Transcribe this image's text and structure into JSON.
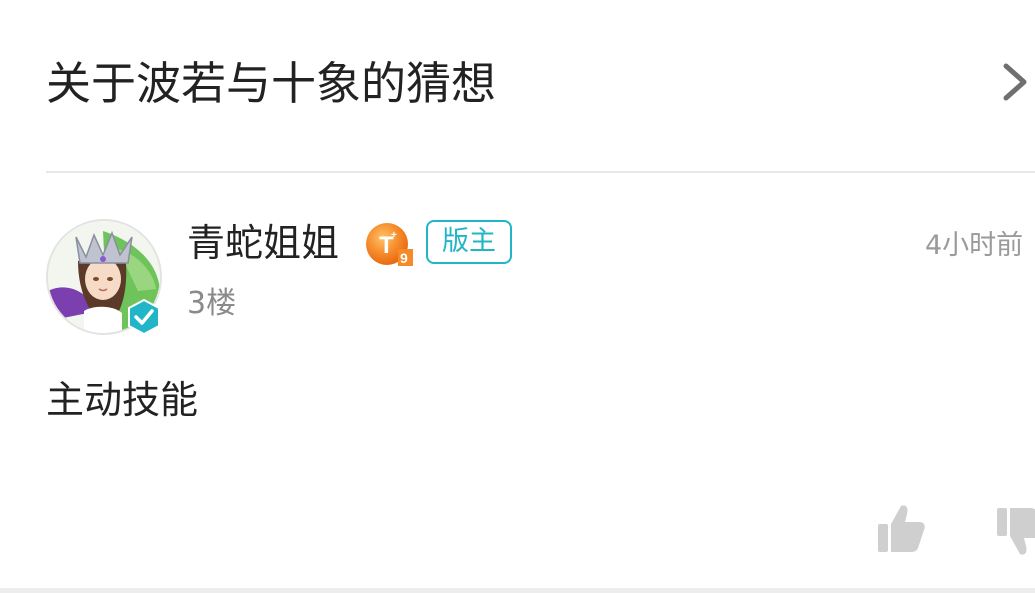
{
  "thread": {
    "title": "关于波若与十象的猜想"
  },
  "post": {
    "username": "青蛇姐姐",
    "level_badge": "T9",
    "role_badge": "版主",
    "floor": "3楼",
    "time": "4小时前",
    "content": "主动技能"
  },
  "icons": {
    "chevron": "chevron-right-icon",
    "verified": "verified-check-icon",
    "like": "thumbs-up-icon",
    "dislike": "thumbs-down-icon"
  },
  "colors": {
    "accent": "#21b5c7",
    "level_badge": "#f58a2a",
    "text": "#222222",
    "secondary_text": "#8a8a8a",
    "icon_gray": "#cfcfcf"
  }
}
